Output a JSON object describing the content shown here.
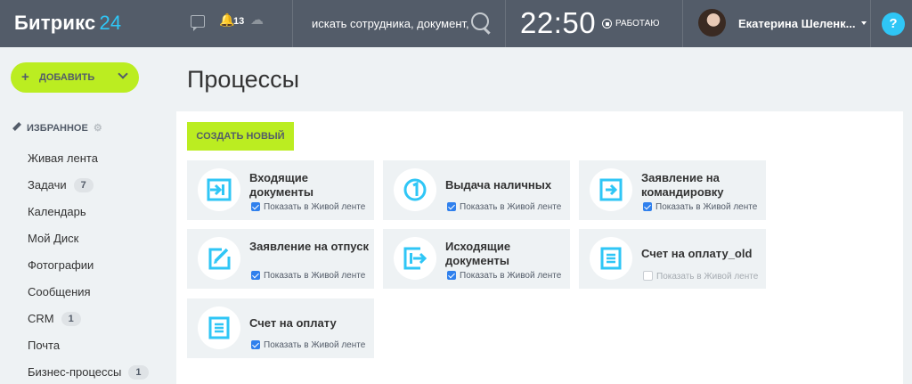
{
  "header": {
    "logo_main": "Битрикс",
    "logo_num": "24",
    "notifications_count": "13",
    "search_placeholder": "искать сотрудника, документ,",
    "clock": "22:50",
    "status": "РАБОТАЮ",
    "user_name": "Екатерина Шеленк...",
    "help": "?"
  },
  "sidebar": {
    "add_button": "ДОБАВИТЬ",
    "favorites_label": "ИЗБРАННОЕ",
    "items": [
      {
        "label": "Живая лента",
        "badge": ""
      },
      {
        "label": "Задачи",
        "badge": "7"
      },
      {
        "label": "Календарь",
        "badge": ""
      },
      {
        "label": "Мой Диск",
        "badge": ""
      },
      {
        "label": "Фотографии",
        "badge": ""
      },
      {
        "label": "Сообщения",
        "badge": ""
      },
      {
        "label": "CRM",
        "badge": "1"
      },
      {
        "label": "Почта",
        "badge": ""
      },
      {
        "label": "Бизнес-процессы",
        "badge": "1"
      }
    ]
  },
  "main": {
    "title": "Процессы",
    "create_button": "СОЗДАТЬ НОВЫЙ",
    "show_in_feed_label": "Показать в Живой ленте",
    "cards": [
      {
        "title": "Входящие документы",
        "icon": "incoming-doc-icon",
        "checked": true
      },
      {
        "title": "Выдача наличных",
        "icon": "cash-icon",
        "checked": true
      },
      {
        "title": "Заявление на командировку",
        "icon": "business-trip-icon",
        "checked": true
      },
      {
        "title": "Заявление на отпуск",
        "icon": "vacation-icon",
        "checked": true
      },
      {
        "title": "Исходящие документы",
        "icon": "outgoing-doc-icon",
        "checked": true
      },
      {
        "title": "Счет на оплату_old",
        "icon": "invoice-icon",
        "checked": false
      },
      {
        "title": "Счет на оплату",
        "icon": "invoice-icon",
        "checked": true
      }
    ]
  },
  "colors": {
    "topbar": "#535c69",
    "accent_green": "#bbed21",
    "icon_blue": "#2fc6f6",
    "checkbox_blue": "#2f80ed"
  }
}
